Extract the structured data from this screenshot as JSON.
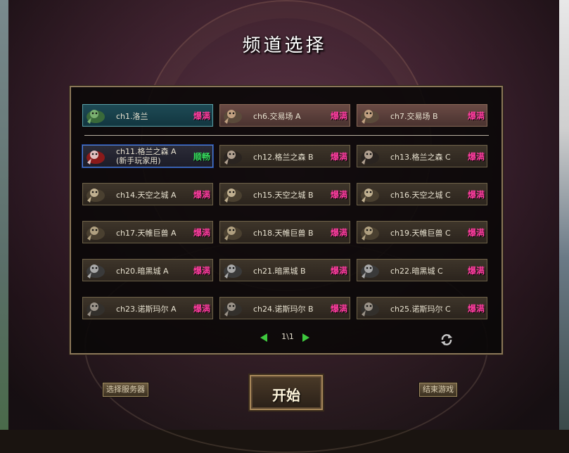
{
  "title": "频道选择",
  "colors": {
    "busy": "#ff3ea0",
    "smooth": "#38e060",
    "accent": "#3ec83e"
  },
  "channels": [
    {
      "name": "ch1.洛兰",
      "name2": "",
      "status": "爆满",
      "icon": "tree-monster-icon"
    },
    {
      "name": "ch6.交易场 A",
      "name2": "",
      "status": "爆满",
      "icon": "merchant-icon"
    },
    {
      "name": "ch7.交易场 B",
      "name2": "",
      "status": "爆满",
      "icon": "merchant-icon"
    },
    {
      "name": "ch11.格兰之森 A",
      "name2": "(新手玩家用)",
      "status": "顺畅",
      "icon": "goblin-red-icon"
    },
    {
      "name": "ch12.格兰之森 B",
      "name2": "",
      "status": "爆满",
      "icon": "goblin-dark-icon"
    },
    {
      "name": "ch13.格兰之森 C",
      "name2": "",
      "status": "爆满",
      "icon": "goblin-dark-icon"
    },
    {
      "name": "ch14.天空之城 A",
      "name2": "",
      "status": "爆满",
      "icon": "harpy-icon"
    },
    {
      "name": "ch15.天空之城 B",
      "name2": "",
      "status": "爆满",
      "icon": "harpy-icon"
    },
    {
      "name": "ch16.天空之城 C",
      "name2": "",
      "status": "爆满",
      "icon": "harpy-icon"
    },
    {
      "name": "ch17.天帷巨兽 A",
      "name2": "",
      "status": "爆满",
      "icon": "beast-icon"
    },
    {
      "name": "ch18.天帷巨兽 B",
      "name2": "",
      "status": "爆满",
      "icon": "beast-icon"
    },
    {
      "name": "ch19.天帷巨兽 C",
      "name2": "",
      "status": "爆满",
      "icon": "beast-icon"
    },
    {
      "name": "ch20.暗黑城 A",
      "name2": "",
      "status": "爆满",
      "icon": "dark-beast-icon"
    },
    {
      "name": "ch21.暗黑城 B",
      "name2": "",
      "status": "爆满",
      "icon": "dark-beast-icon"
    },
    {
      "name": "ch22.暗黑城 C",
      "name2": "",
      "status": "爆满",
      "icon": "dark-beast-icon"
    },
    {
      "name": "ch23.诺斯玛尔 A",
      "name2": "",
      "status": "爆满",
      "icon": "wolf-icon"
    },
    {
      "name": "ch24.诺斯玛尔 B",
      "name2": "",
      "status": "爆满",
      "icon": "wolf-icon"
    },
    {
      "name": "ch25.诺斯玛尔 C",
      "name2": "",
      "status": "爆满",
      "icon": "wolf-icon"
    }
  ],
  "pager": {
    "text": "1\\1",
    "prev_icon": "arrow-left-icon",
    "next_icon": "arrow-right-icon"
  },
  "buttons": {
    "select_server": "选择服务器",
    "start": "开始",
    "exit": "结束游戏"
  }
}
